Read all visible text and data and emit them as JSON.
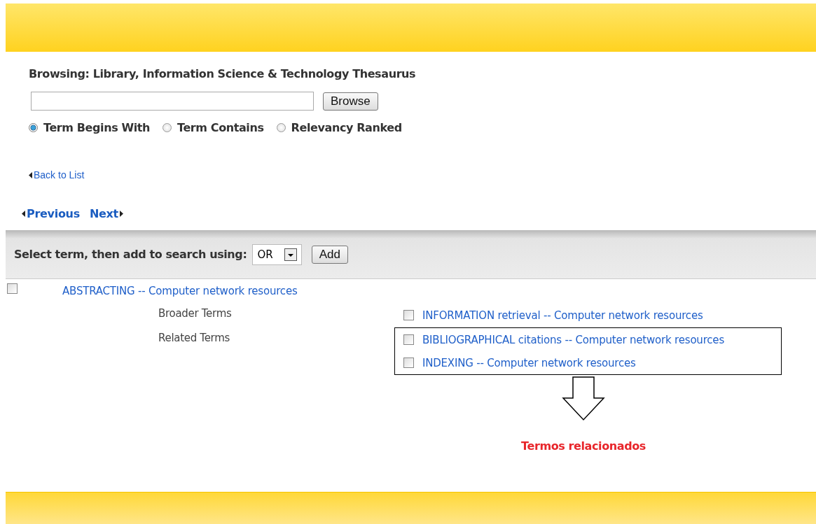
{
  "heading": "Browsing: Library, Information Science & Technology Thesaurus",
  "search": {
    "button": "Browse"
  },
  "modes": [
    {
      "label": "Term Begins With",
      "selected": true
    },
    {
      "label": "Term Contains",
      "selected": false
    },
    {
      "label": "Relevancy Ranked",
      "selected": false
    }
  ],
  "back_link": "Back to List",
  "pager": {
    "previous": "Previous",
    "next": "Next"
  },
  "toolbar": {
    "label": "Select term, then add to search using:",
    "operator": "OR",
    "button": "Add"
  },
  "term": {
    "label": "ABSTRACTING -- Computer network resources",
    "checked": false
  },
  "groups": [
    {
      "label": "Broader Terms",
      "highlighted": false,
      "terms": [
        {
          "label": "INFORMATION retrieval -- Computer network resources",
          "checked": false
        }
      ]
    },
    {
      "label": "Related Terms",
      "highlighted": true,
      "terms": [
        {
          "label": "BIBLIOGRAPHICAL citations -- Computer network resources",
          "checked": false
        },
        {
          "label": "INDEXING -- Computer network resources",
          "checked": false
        }
      ]
    }
  ],
  "annotation": "Termos relacionados"
}
